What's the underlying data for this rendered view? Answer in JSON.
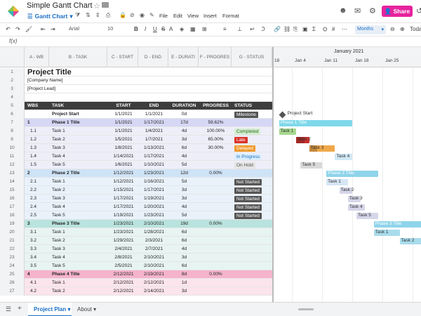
{
  "app": {
    "doc_title": "Simple Gantt Chart",
    "view": "Gantt Chart",
    "menu": [
      "File",
      "Edit",
      "View",
      "Insert",
      "Format"
    ],
    "share_label": "Share",
    "font": "Arial",
    "font_size": "10",
    "zoom": "Months",
    "today_label": "Toda",
    "fx": "f(x)",
    "brand_color": "#e6239e",
    "accent_color": "#1a6fc6"
  },
  "columns": [
    "A - WB",
    "B - TASK",
    "C - START",
    "D - END",
    "E - DURATI",
    "F - PROGRES",
    "G - STATUS"
  ],
  "header_rows": [
    {
      "n": "1",
      "text": "Project Title"
    },
    {
      "n": "2",
      "text": "[Company Name]"
    },
    {
      "n": "3",
      "text": "[Project Lead]"
    },
    {
      "n": "4",
      "text": ""
    }
  ],
  "table_header": {
    "n": "5",
    "wbs": "WBS",
    "task": "TASK",
    "start": "START",
    "end": "END",
    "duration": "DURATION",
    "progress": "PROGRESS",
    "status": "STATUS"
  },
  "rows": [
    {
      "n": "6",
      "wbs": "",
      "task": "Project Start",
      "start": "1/1/2021",
      "end": "1/1/2021",
      "dur": "0d",
      "prog": "",
      "status": "Milestone",
      "kind": "milestone"
    },
    {
      "n": "7",
      "wbs": "1",
      "task": "Phase 1 Title",
      "start": "1/1/2021",
      "end": "1/17/2021",
      "dur": "17d",
      "prog": "59.62%",
      "status": "",
      "kind": "p1h"
    },
    {
      "n": "8",
      "wbs": "1.1",
      "task": "Task 1",
      "start": "1/1/2021",
      "end": "1/4/2021",
      "dur": "4d",
      "prog": "100.00%",
      "status": "Completed",
      "kind": "p1"
    },
    {
      "n": "9",
      "wbs": "1.2",
      "task": "Task 2",
      "start": "1/5/2021",
      "end": "1/7/2021",
      "dur": "3d",
      "prog": "65.00%",
      "status": "Late",
      "kind": "p1"
    },
    {
      "n": "10",
      "wbs": "1.3",
      "task": "Task 3",
      "start": "1/8/2021",
      "end": "1/13/2021",
      "dur": "6d",
      "prog": "30.00%",
      "status": "Delayed",
      "kind": "p1"
    },
    {
      "n": "11",
      "wbs": "1.4",
      "task": "Task 4",
      "start": "1/14/2021",
      "end": "1/17/2021",
      "dur": "4d",
      "prog": "",
      "status": "In Progress",
      "kind": "p1"
    },
    {
      "n": "12",
      "wbs": "1.5",
      "task": "Task 5",
      "start": "1/6/2021",
      "end": "1/10/2021",
      "dur": "5d",
      "prog": "",
      "status": "On Hold",
      "kind": "p1"
    },
    {
      "n": "13",
      "wbs": "2",
      "task": "Phase 2 Title",
      "start": "1/12/2021",
      "end": "1/23/2021",
      "dur": "12d",
      "prog": "0.00%",
      "status": "",
      "kind": "p2h"
    },
    {
      "n": "14",
      "wbs": "2.1",
      "task": "Task 1",
      "start": "1/12/2021",
      "end": "1/16/2021",
      "dur": "5d",
      "prog": "",
      "status": "Not Started",
      "kind": "p2"
    },
    {
      "n": "15",
      "wbs": "2.2",
      "task": "Task 2",
      "start": "1/15/2021",
      "end": "1/17/2021",
      "dur": "3d",
      "prog": "",
      "status": "Not Started",
      "kind": "p2"
    },
    {
      "n": "16",
      "wbs": "2.3",
      "task": "Task 3",
      "start": "1/17/2021",
      "end": "1/19/2021",
      "dur": "3d",
      "prog": "",
      "status": "Not Started",
      "kind": "p2"
    },
    {
      "n": "17",
      "wbs": "2.4",
      "task": "Task 4",
      "start": "1/17/2021",
      "end": "1/20/2021",
      "dur": "4d",
      "prog": "",
      "status": "Not Started",
      "kind": "p2"
    },
    {
      "n": "18",
      "wbs": "2.5",
      "task": "Task 5",
      "start": "1/19/2021",
      "end": "1/23/2021",
      "dur": "5d",
      "prog": "",
      "status": "Not Started",
      "kind": "p2"
    },
    {
      "n": "19",
      "wbs": "3",
      "task": "Phase 3 Title",
      "start": "1/23/2021",
      "end": "2/10/2021",
      "dur": "19d",
      "prog": "0.00%",
      "status": "",
      "kind": "p3h"
    },
    {
      "n": "20",
      "wbs": "3.1",
      "task": "Task 1",
      "start": "1/23/2021",
      "end": "1/28/2021",
      "dur": "6d",
      "prog": "",
      "status": "",
      "kind": "p3"
    },
    {
      "n": "21",
      "wbs": "3.2",
      "task": "Task 2",
      "start": "1/29/2021",
      "end": "2/3/2021",
      "dur": "6d",
      "prog": "",
      "status": "",
      "kind": "p3"
    },
    {
      "n": "22",
      "wbs": "3.3",
      "task": "Task 3",
      "start": "2/4/2021",
      "end": "2/7/2021",
      "dur": "4d",
      "prog": "",
      "status": "",
      "kind": "p3"
    },
    {
      "n": "23",
      "wbs": "3.4",
      "task": "Task 4",
      "start": "2/8/2021",
      "end": "2/10/2021",
      "dur": "3d",
      "prog": "",
      "status": "",
      "kind": "p3"
    },
    {
      "n": "24",
      "wbs": "3.5",
      "task": "Task 5",
      "start": "2/5/2021",
      "end": "2/10/2021",
      "dur": "6d",
      "prog": "",
      "status": "",
      "kind": "p3"
    },
    {
      "n": "25",
      "wbs": "4",
      "task": "Phase 4 Title",
      "start": "2/12/2021",
      "end": "2/19/2021",
      "dur": "8d",
      "prog": "0.00%",
      "status": "",
      "kind": "p4h"
    },
    {
      "n": "26",
      "wbs": "4.1",
      "task": "Task 1",
      "start": "2/12/2021",
      "end": "2/12/2021",
      "dur": "1d",
      "prog": "",
      "status": "",
      "kind": "p4"
    },
    {
      "n": "27",
      "wbs": "4.2",
      "task": "Task 2",
      "start": "2/12/2021",
      "end": "2/14/2021",
      "dur": "3d",
      "prog": "",
      "status": "",
      "kind": "p4"
    }
  ],
  "gantt": {
    "month": "January 2021",
    "weeks": [
      "18",
      "Jan 4",
      "Jan 11",
      "Jan 18",
      "Jan 25"
    ],
    "first_week": "Jan 4",
    "status_colors": {
      "Milestone": "#555555",
      "Completed": "#d3ecce",
      "Late": "#d9342b",
      "Delayed": "#f09a2c",
      "In Progress": "#dbeefc",
      "On Hold": "#e4e4e4",
      "Not Started": "#555555"
    },
    "bars": [
      {
        "row": "6",
        "label": "Project Start",
        "type": "milestone"
      },
      {
        "row": "7",
        "label": "Phase 1 Title",
        "color": "#7fd8ea",
        "text_color": "#ffffff",
        "type": "summary"
      },
      {
        "row": "8",
        "label": "Task 1",
        "color": "#a7d88f"
      },
      {
        "row": "9",
        "label": "Task 2",
        "color": "#c9302c",
        "fill": 0.65
      },
      {
        "row": "10",
        "label": "Task 3",
        "color": "#f0a84a",
        "fill": 0.3
      },
      {
        "row": "11",
        "label": "Task 4",
        "color": "#cfe8f6"
      },
      {
        "row": "12",
        "label": "Task 5",
        "color": "#d9d9d9"
      },
      {
        "row": "13",
        "label": "Phase 2 Title",
        "color": "#8fd4ea",
        "text_color": "#ffffff",
        "type": "summary"
      },
      {
        "row": "14",
        "label": "Task 1",
        "color": "#d6e6f5"
      },
      {
        "row": "15",
        "label": "Task 2",
        "color": "#d6d6ea"
      },
      {
        "row": "16",
        "label": "Task 3",
        "color": "#d6d6ea"
      },
      {
        "row": "17",
        "label": "Task 4",
        "color": "#d6d6ea"
      },
      {
        "row": "18",
        "label": "Task 5",
        "color": "#d6d6ea"
      },
      {
        "row": "19",
        "label": "Phase 3 Title",
        "color": "#8fd4ea",
        "text_color": "#ffffff",
        "type": "summary"
      },
      {
        "row": "20",
        "label": "Task 1",
        "color": "#a9dcec"
      },
      {
        "row": "21",
        "label": "Task 2",
        "color": "#a9dcec"
      }
    ]
  },
  "sheets": {
    "active": "Project Plan",
    "other": "About"
  }
}
